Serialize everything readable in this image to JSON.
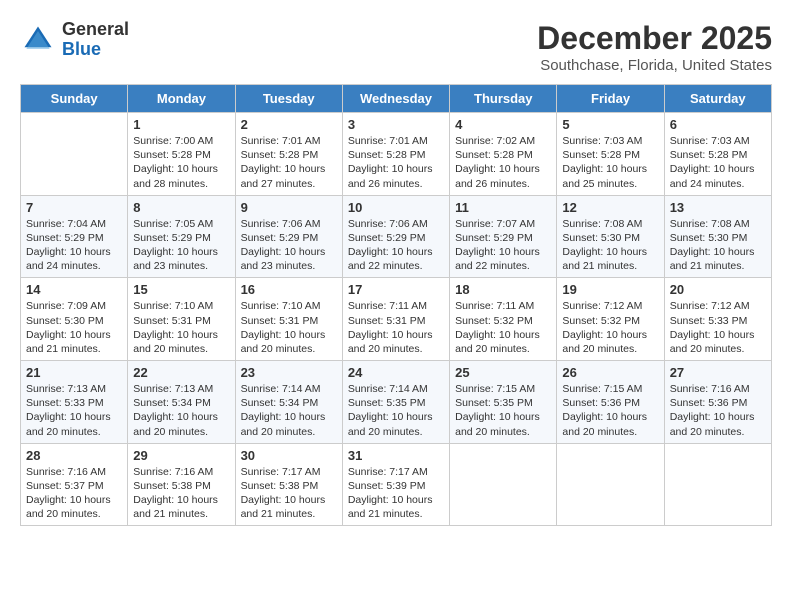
{
  "header": {
    "logo_general": "General",
    "logo_blue": "Blue",
    "title": "December 2025",
    "location": "Southchase, Florida, United States"
  },
  "days_of_week": [
    "Sunday",
    "Monday",
    "Tuesday",
    "Wednesday",
    "Thursday",
    "Friday",
    "Saturday"
  ],
  "weeks": [
    [
      {
        "date": "",
        "info": ""
      },
      {
        "date": "1",
        "sunrise": "Sunrise: 7:00 AM",
        "sunset": "Sunset: 5:28 PM",
        "daylight": "Daylight: 10 hours and 28 minutes."
      },
      {
        "date": "2",
        "sunrise": "Sunrise: 7:01 AM",
        "sunset": "Sunset: 5:28 PM",
        "daylight": "Daylight: 10 hours and 27 minutes."
      },
      {
        "date": "3",
        "sunrise": "Sunrise: 7:01 AM",
        "sunset": "Sunset: 5:28 PM",
        "daylight": "Daylight: 10 hours and 26 minutes."
      },
      {
        "date": "4",
        "sunrise": "Sunrise: 7:02 AM",
        "sunset": "Sunset: 5:28 PM",
        "daylight": "Daylight: 10 hours and 26 minutes."
      },
      {
        "date": "5",
        "sunrise": "Sunrise: 7:03 AM",
        "sunset": "Sunset: 5:28 PM",
        "daylight": "Daylight: 10 hours and 25 minutes."
      },
      {
        "date": "6",
        "sunrise": "Sunrise: 7:03 AM",
        "sunset": "Sunset: 5:28 PM",
        "daylight": "Daylight: 10 hours and 24 minutes."
      }
    ],
    [
      {
        "date": "7",
        "sunrise": "Sunrise: 7:04 AM",
        "sunset": "Sunset: 5:29 PM",
        "daylight": "Daylight: 10 hours and 24 minutes."
      },
      {
        "date": "8",
        "sunrise": "Sunrise: 7:05 AM",
        "sunset": "Sunset: 5:29 PM",
        "daylight": "Daylight: 10 hours and 23 minutes."
      },
      {
        "date": "9",
        "sunrise": "Sunrise: 7:06 AM",
        "sunset": "Sunset: 5:29 PM",
        "daylight": "Daylight: 10 hours and 23 minutes."
      },
      {
        "date": "10",
        "sunrise": "Sunrise: 7:06 AM",
        "sunset": "Sunset: 5:29 PM",
        "daylight": "Daylight: 10 hours and 22 minutes."
      },
      {
        "date": "11",
        "sunrise": "Sunrise: 7:07 AM",
        "sunset": "Sunset: 5:29 PM",
        "daylight": "Daylight: 10 hours and 22 minutes."
      },
      {
        "date": "12",
        "sunrise": "Sunrise: 7:08 AM",
        "sunset": "Sunset: 5:30 PM",
        "daylight": "Daylight: 10 hours and 21 minutes."
      },
      {
        "date": "13",
        "sunrise": "Sunrise: 7:08 AM",
        "sunset": "Sunset: 5:30 PM",
        "daylight": "Daylight: 10 hours and 21 minutes."
      }
    ],
    [
      {
        "date": "14",
        "sunrise": "Sunrise: 7:09 AM",
        "sunset": "Sunset: 5:30 PM",
        "daylight": "Daylight: 10 hours and 21 minutes."
      },
      {
        "date": "15",
        "sunrise": "Sunrise: 7:10 AM",
        "sunset": "Sunset: 5:31 PM",
        "daylight": "Daylight: 10 hours and 20 minutes."
      },
      {
        "date": "16",
        "sunrise": "Sunrise: 7:10 AM",
        "sunset": "Sunset: 5:31 PM",
        "daylight": "Daylight: 10 hours and 20 minutes."
      },
      {
        "date": "17",
        "sunrise": "Sunrise: 7:11 AM",
        "sunset": "Sunset: 5:31 PM",
        "daylight": "Daylight: 10 hours and 20 minutes."
      },
      {
        "date": "18",
        "sunrise": "Sunrise: 7:11 AM",
        "sunset": "Sunset: 5:32 PM",
        "daylight": "Daylight: 10 hours and 20 minutes."
      },
      {
        "date": "19",
        "sunrise": "Sunrise: 7:12 AM",
        "sunset": "Sunset: 5:32 PM",
        "daylight": "Daylight: 10 hours and 20 minutes."
      },
      {
        "date": "20",
        "sunrise": "Sunrise: 7:12 AM",
        "sunset": "Sunset: 5:33 PM",
        "daylight": "Daylight: 10 hours and 20 minutes."
      }
    ],
    [
      {
        "date": "21",
        "sunrise": "Sunrise: 7:13 AM",
        "sunset": "Sunset: 5:33 PM",
        "daylight": "Daylight: 10 hours and 20 minutes."
      },
      {
        "date": "22",
        "sunrise": "Sunrise: 7:13 AM",
        "sunset": "Sunset: 5:34 PM",
        "daylight": "Daylight: 10 hours and 20 minutes."
      },
      {
        "date": "23",
        "sunrise": "Sunrise: 7:14 AM",
        "sunset": "Sunset: 5:34 PM",
        "daylight": "Daylight: 10 hours and 20 minutes."
      },
      {
        "date": "24",
        "sunrise": "Sunrise: 7:14 AM",
        "sunset": "Sunset: 5:35 PM",
        "daylight": "Daylight: 10 hours and 20 minutes."
      },
      {
        "date": "25",
        "sunrise": "Sunrise: 7:15 AM",
        "sunset": "Sunset: 5:35 PM",
        "daylight": "Daylight: 10 hours and 20 minutes."
      },
      {
        "date": "26",
        "sunrise": "Sunrise: 7:15 AM",
        "sunset": "Sunset: 5:36 PM",
        "daylight": "Daylight: 10 hours and 20 minutes."
      },
      {
        "date": "27",
        "sunrise": "Sunrise: 7:16 AM",
        "sunset": "Sunset: 5:36 PM",
        "daylight": "Daylight: 10 hours and 20 minutes."
      }
    ],
    [
      {
        "date": "28",
        "sunrise": "Sunrise: 7:16 AM",
        "sunset": "Sunset: 5:37 PM",
        "daylight": "Daylight: 10 hours and 20 minutes."
      },
      {
        "date": "29",
        "sunrise": "Sunrise: 7:16 AM",
        "sunset": "Sunset: 5:38 PM",
        "daylight": "Daylight: 10 hours and 21 minutes."
      },
      {
        "date": "30",
        "sunrise": "Sunrise: 7:17 AM",
        "sunset": "Sunset: 5:38 PM",
        "daylight": "Daylight: 10 hours and 21 minutes."
      },
      {
        "date": "31",
        "sunrise": "Sunrise: 7:17 AM",
        "sunset": "Sunset: 5:39 PM",
        "daylight": "Daylight: 10 hours and 21 minutes."
      },
      {
        "date": "",
        "info": ""
      },
      {
        "date": "",
        "info": ""
      },
      {
        "date": "",
        "info": ""
      }
    ]
  ]
}
